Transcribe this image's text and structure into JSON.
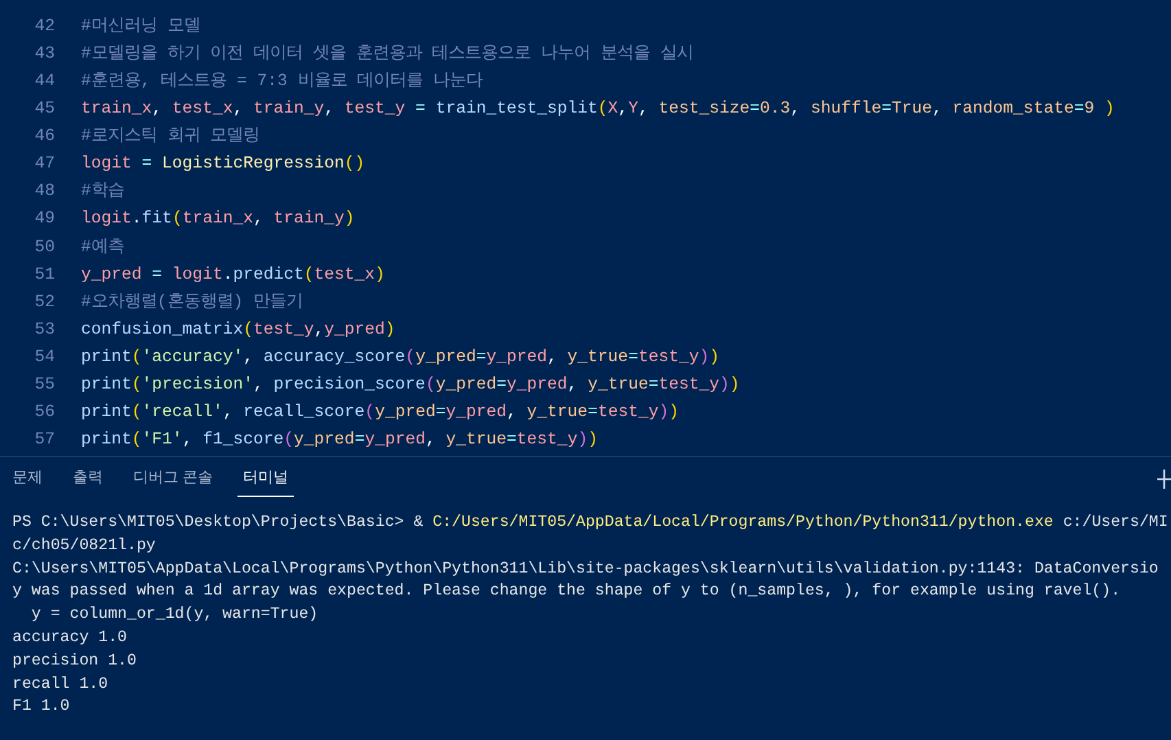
{
  "editor": {
    "lines": [
      {
        "number": "42",
        "tokens": [
          {
            "kind": "c",
            "text": "#머신러닝 모델"
          }
        ]
      },
      {
        "number": "43",
        "tokens": [
          {
            "kind": "c",
            "text": "#모델링을 하기 이전 데이터 셋을 훈련용과 테스트용으로 나누어 분석을 실시"
          }
        ]
      },
      {
        "number": "44",
        "tokens": [
          {
            "kind": "c",
            "text": "#훈련용, 테스트용 = 7:3 비율로 데이터를 나눈다"
          }
        ]
      },
      {
        "number": "45",
        "tokens": [
          {
            "kind": "v",
            "text": "train_x"
          },
          {
            "kind": "p",
            "text": ", "
          },
          {
            "kind": "v",
            "text": "test_x"
          },
          {
            "kind": "p",
            "text": ", "
          },
          {
            "kind": "v",
            "text": "train_y"
          },
          {
            "kind": "p",
            "text": ", "
          },
          {
            "kind": "v",
            "text": "test_y"
          },
          {
            "kind": "o",
            "text": " = "
          },
          {
            "kind": "f",
            "text": "train_test_split"
          },
          {
            "kind": "b1",
            "text": "("
          },
          {
            "kind": "v",
            "text": "X"
          },
          {
            "kind": "p",
            "text": ","
          },
          {
            "kind": "v",
            "text": "Y"
          },
          {
            "kind": "p",
            "text": ", "
          },
          {
            "kind": "a",
            "text": "test_size"
          },
          {
            "kind": "o",
            "text": "="
          },
          {
            "kind": "a",
            "text": "0.3"
          },
          {
            "kind": "p",
            "text": ", "
          },
          {
            "kind": "a",
            "text": "shuffle"
          },
          {
            "kind": "o",
            "text": "="
          },
          {
            "kind": "a",
            "text": "True"
          },
          {
            "kind": "p",
            "text": ", "
          },
          {
            "kind": "a",
            "text": "random_state"
          },
          {
            "kind": "o",
            "text": "="
          },
          {
            "kind": "a",
            "text": "9"
          },
          {
            "kind": "b1",
            "text": " )"
          }
        ]
      },
      {
        "number": "46",
        "tokens": [
          {
            "kind": "c",
            "text": "#로지스틱 회귀 모델링"
          }
        ]
      },
      {
        "number": "47",
        "tokens": [
          {
            "kind": "v",
            "text": "logit"
          },
          {
            "kind": "o",
            "text": " = "
          },
          {
            "kind": "k",
            "text": "LogisticRegression"
          },
          {
            "kind": "b1",
            "text": "()"
          }
        ]
      },
      {
        "number": "48",
        "tokens": [
          {
            "kind": "c",
            "text": "#학습"
          }
        ]
      },
      {
        "number": "49",
        "tokens": [
          {
            "kind": "v",
            "text": "logit"
          },
          {
            "kind": "p",
            "text": "."
          },
          {
            "kind": "f",
            "text": "fit"
          },
          {
            "kind": "b1",
            "text": "("
          },
          {
            "kind": "v",
            "text": "train_x"
          },
          {
            "kind": "p",
            "text": ", "
          },
          {
            "kind": "v",
            "text": "train_y"
          },
          {
            "kind": "b1",
            "text": ")"
          }
        ]
      },
      {
        "number": "50",
        "tokens": [
          {
            "kind": "c",
            "text": "#예측"
          }
        ]
      },
      {
        "number": "51",
        "tokens": [
          {
            "kind": "v",
            "text": "y_pred"
          },
          {
            "kind": "o",
            "text": " = "
          },
          {
            "kind": "v",
            "text": "logit"
          },
          {
            "kind": "p",
            "text": "."
          },
          {
            "kind": "f",
            "text": "predict"
          },
          {
            "kind": "b1",
            "text": "("
          },
          {
            "kind": "v",
            "text": "test_x"
          },
          {
            "kind": "b1",
            "text": ")"
          }
        ]
      },
      {
        "number": "52",
        "tokens": [
          {
            "kind": "c",
            "text": "#오차행렬(혼동행렬) 만들기"
          }
        ]
      },
      {
        "number": "53",
        "tokens": [
          {
            "kind": "f",
            "text": "confusion_matrix"
          },
          {
            "kind": "b1",
            "text": "("
          },
          {
            "kind": "v",
            "text": "test_y"
          },
          {
            "kind": "p",
            "text": ","
          },
          {
            "kind": "v",
            "text": "y_pred"
          },
          {
            "kind": "b1",
            "text": ")"
          }
        ]
      },
      {
        "number": "54",
        "tokens": [
          {
            "kind": "f",
            "text": "print"
          },
          {
            "kind": "b1",
            "text": "("
          },
          {
            "kind": "s",
            "text": "'accuracy'"
          },
          {
            "kind": "p",
            "text": ", "
          },
          {
            "kind": "f",
            "text": "accuracy_score"
          },
          {
            "kind": "b2",
            "text": "("
          },
          {
            "kind": "a",
            "text": "y_pred"
          },
          {
            "kind": "o",
            "text": "="
          },
          {
            "kind": "v",
            "text": "y_pred"
          },
          {
            "kind": "p",
            "text": ", "
          },
          {
            "kind": "a",
            "text": "y_true"
          },
          {
            "kind": "o",
            "text": "="
          },
          {
            "kind": "v",
            "text": "test_y"
          },
          {
            "kind": "b2",
            "text": ")"
          },
          {
            "kind": "b1",
            "text": ")"
          }
        ]
      },
      {
        "number": "55",
        "tokens": [
          {
            "kind": "f",
            "text": "print"
          },
          {
            "kind": "b1",
            "text": "("
          },
          {
            "kind": "s",
            "text": "'precision'"
          },
          {
            "kind": "p",
            "text": ", "
          },
          {
            "kind": "f",
            "text": "precision_score"
          },
          {
            "kind": "b2",
            "text": "("
          },
          {
            "kind": "a",
            "text": "y_pred"
          },
          {
            "kind": "o",
            "text": "="
          },
          {
            "kind": "v",
            "text": "y_pred"
          },
          {
            "kind": "p",
            "text": ", "
          },
          {
            "kind": "a",
            "text": "y_true"
          },
          {
            "kind": "o",
            "text": "="
          },
          {
            "kind": "v",
            "text": "test_y"
          },
          {
            "kind": "b2",
            "text": ")"
          },
          {
            "kind": "b1",
            "text": ")"
          }
        ]
      },
      {
        "number": "56",
        "tokens": [
          {
            "kind": "f",
            "text": "print"
          },
          {
            "kind": "b1",
            "text": "("
          },
          {
            "kind": "s",
            "text": "'recall'"
          },
          {
            "kind": "p",
            "text": ", "
          },
          {
            "kind": "f",
            "text": "recall_score"
          },
          {
            "kind": "b2",
            "text": "("
          },
          {
            "kind": "a",
            "text": "y_pred"
          },
          {
            "kind": "o",
            "text": "="
          },
          {
            "kind": "v",
            "text": "y_pred"
          },
          {
            "kind": "p",
            "text": ", "
          },
          {
            "kind": "a",
            "text": "y_true"
          },
          {
            "kind": "o",
            "text": "="
          },
          {
            "kind": "v",
            "text": "test_y"
          },
          {
            "kind": "b2",
            "text": ")"
          },
          {
            "kind": "b1",
            "text": ")"
          }
        ]
      },
      {
        "number": "57",
        "tokens": [
          {
            "kind": "f",
            "text": "print"
          },
          {
            "kind": "b1",
            "text": "("
          },
          {
            "kind": "s",
            "text": "'F1'"
          },
          {
            "kind": "p",
            "text": ", "
          },
          {
            "kind": "f",
            "text": "f1_score"
          },
          {
            "kind": "b2",
            "text": "("
          },
          {
            "kind": "a",
            "text": "y_pred"
          },
          {
            "kind": "o",
            "text": "="
          },
          {
            "kind": "v",
            "text": "y_pred"
          },
          {
            "kind": "p",
            "text": ", "
          },
          {
            "kind": "a",
            "text": "y_true"
          },
          {
            "kind": "o",
            "text": "="
          },
          {
            "kind": "v",
            "text": "test_y"
          },
          {
            "kind": "b2",
            "text": ")"
          },
          {
            "kind": "b1",
            "text": ")"
          }
        ]
      }
    ]
  },
  "panel": {
    "tabs": [
      {
        "label": "문제",
        "selected": false
      },
      {
        "label": "출력",
        "selected": false
      },
      {
        "label": "디버그 콘솔",
        "selected": false
      },
      {
        "label": "터미널",
        "selected": true
      }
    ],
    "terminal_lines": [
      {
        "segments": [
          {
            "kind": "p",
            "text": "PS C:\\Users\\MIT05\\Desktop\\Projects\\Basic> & "
          },
          {
            "kind": "y",
            "text": "C:/Users/MIT05/AppData/Local/Programs/Python/Python311/python.exe"
          },
          {
            "kind": "p",
            "text": " c:/Users/MI"
          }
        ]
      },
      {
        "segments": [
          {
            "kind": "p",
            "text": "c/ch05/0821l.py"
          }
        ]
      },
      {
        "segments": [
          {
            "kind": "p",
            "text": "C:\\Users\\MIT05\\AppData\\Local\\Programs\\Python\\Python311\\Lib\\site-packages\\sklearn\\utils\\validation.py:1143: DataConversio"
          }
        ]
      },
      {
        "segments": [
          {
            "kind": "p",
            "text": "y was passed when a 1d array was expected. Please change the shape of y to (n_samples, ), for example using ravel()."
          }
        ]
      },
      {
        "segments": [
          {
            "kind": "p",
            "text": "  y = column_or_1d(y, warn=True)"
          }
        ]
      },
      {
        "segments": [
          {
            "kind": "p",
            "text": "accuracy 1.0"
          }
        ]
      },
      {
        "segments": [
          {
            "kind": "p",
            "text": "precision 1.0"
          }
        ]
      },
      {
        "segments": [
          {
            "kind": "p",
            "text": "recall 1.0"
          }
        ]
      },
      {
        "segments": [
          {
            "kind": "p",
            "text": "F1 1.0"
          }
        ]
      }
    ]
  }
}
